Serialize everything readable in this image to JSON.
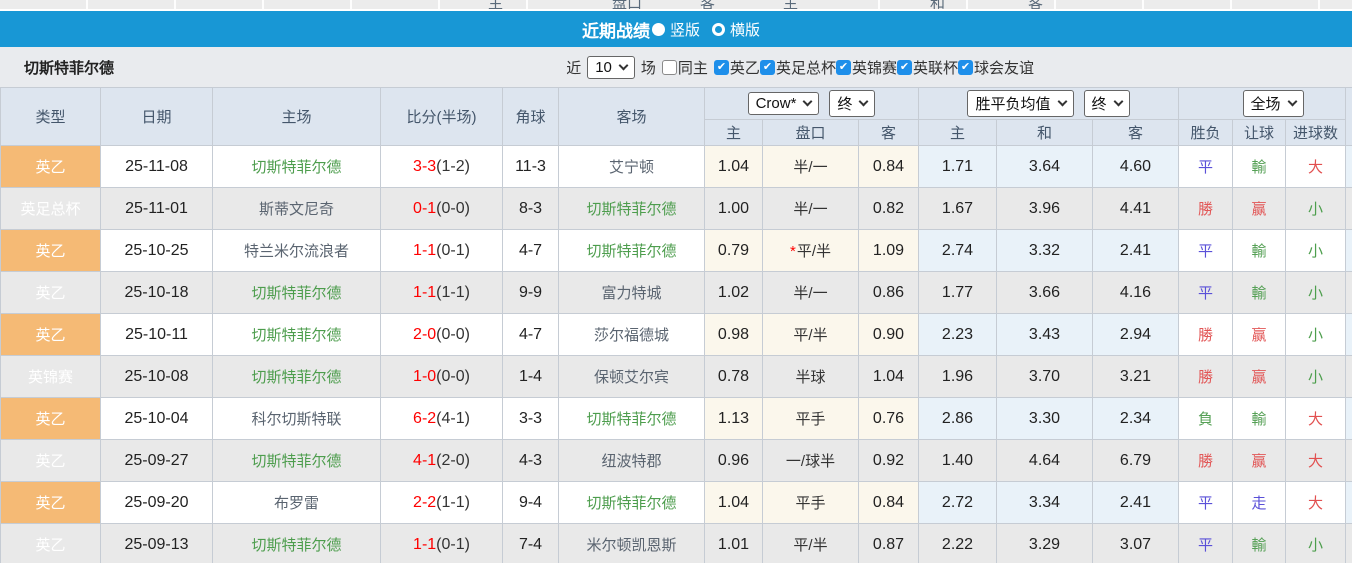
{
  "top_strip": {
    "labels": [
      "主",
      "盘口",
      "客",
      "主",
      "和",
      "客"
    ]
  },
  "title_bar": {
    "title": "近期战绩",
    "radios": [
      {
        "label": "竖版",
        "selected": true
      },
      {
        "label": "横版",
        "selected": false
      }
    ]
  },
  "filter_bar": {
    "team": "切斯特菲尔德",
    "near_label": "近",
    "count_value": "10",
    "games_label": "场",
    "same_home": {
      "label": "同主",
      "checked": false
    },
    "leagues": [
      {
        "label": "英乙",
        "checked": true
      },
      {
        "label": "英足总杯",
        "checked": true
      },
      {
        "label": "英锦赛",
        "checked": true
      },
      {
        "label": "英联杯",
        "checked": true
      },
      {
        "label": "球会友谊",
        "checked": true
      }
    ]
  },
  "table": {
    "headers": {
      "type": "类型",
      "date": "日期",
      "home": "主场",
      "score": "比分(半场)",
      "corner": "角球",
      "away": "客场",
      "odds_home": "主",
      "odds_line": "盘口",
      "odds_away": "客",
      "mean_home": "主",
      "mean_draw": "和",
      "mean_away": "客",
      "result": "胜负",
      "handicap": "让球",
      "goals": "进球数"
    },
    "selectors": {
      "bookmaker": "Crow*",
      "odds_time": "终",
      "mean_label": "胜平负均值",
      "mean_time": "终",
      "scope": "全场"
    },
    "rows": [
      {
        "league": "英乙",
        "league_style": "orange",
        "date": "25-11-08",
        "home": "切斯特菲尔德",
        "home_self": true,
        "score": "3-3",
        "half": "(1-2)",
        "corner": "11-3",
        "away": "艾宁顿",
        "away_self": false,
        "odds_home": "1.04",
        "line": "半/一",
        "line_star": false,
        "odds_away": "0.84",
        "mean_home": "1.71",
        "mean_draw": "3.64",
        "mean_away": "4.60",
        "result": "平",
        "result_state": "draw",
        "handicap": "輸",
        "handicap_state": "lose",
        "goals": "大",
        "goals_state": "over"
      },
      {
        "league": "英足总杯",
        "league_style": "blue",
        "date": "25-11-01",
        "home": "斯蒂文尼奇",
        "home_self": false,
        "score": "0-1",
        "half": "(0-0)",
        "corner": "8-3",
        "away": "切斯特菲尔德",
        "away_self": true,
        "odds_home": "1.00",
        "line": "半/一",
        "line_star": false,
        "odds_away": "0.82",
        "mean_home": "1.67",
        "mean_draw": "3.96",
        "mean_away": "4.41",
        "result": "勝",
        "result_state": "win",
        "handicap": "赢",
        "handicap_state": "win",
        "goals": "小",
        "goals_state": "under"
      },
      {
        "league": "英乙",
        "league_style": "orange",
        "date": "25-10-25",
        "home": "特兰米尔流浪者",
        "home_self": false,
        "score": "1-1",
        "half": "(0-1)",
        "corner": "4-7",
        "away": "切斯特菲尔德",
        "away_self": true,
        "odds_home": "0.79",
        "line": "平/半",
        "line_star": true,
        "odds_away": "1.09",
        "mean_home": "2.74",
        "mean_draw": "3.32",
        "mean_away": "2.41",
        "result": "平",
        "result_state": "draw",
        "handicap": "輸",
        "handicap_state": "lose",
        "goals": "小",
        "goals_state": "under"
      },
      {
        "league": "英乙",
        "league_style": "orange",
        "date": "25-10-18",
        "home": "切斯特菲尔德",
        "home_self": true,
        "score": "1-1",
        "half": "(1-1)",
        "corner": "9-9",
        "away": "富力特城",
        "away_self": false,
        "odds_home": "1.02",
        "line": "半/一",
        "line_star": false,
        "odds_away": "0.86",
        "mean_home": "1.77",
        "mean_draw": "3.66",
        "mean_away": "4.16",
        "result": "平",
        "result_state": "draw",
        "handicap": "輸",
        "handicap_state": "lose",
        "goals": "小",
        "goals_state": "under"
      },
      {
        "league": "英乙",
        "league_style": "orange",
        "date": "25-10-11",
        "home": "切斯特菲尔德",
        "home_self": true,
        "score": "2-0",
        "half": "(0-0)",
        "corner": "4-7",
        "away": "莎尔福德城",
        "away_self": false,
        "odds_home": "0.98",
        "line": "平/半",
        "line_star": false,
        "odds_away": "0.90",
        "mean_home": "2.23",
        "mean_draw": "3.43",
        "mean_away": "2.94",
        "result": "勝",
        "result_state": "win",
        "handicap": "赢",
        "handicap_state": "win",
        "goals": "小",
        "goals_state": "under"
      },
      {
        "league": "英锦赛",
        "league_style": "pink",
        "date": "25-10-08",
        "home": "切斯特菲尔德",
        "home_self": true,
        "score": "1-0",
        "half": "(0-0)",
        "corner": "1-4",
        "away": "保顿艾尔宾",
        "away_self": false,
        "odds_home": "0.78",
        "line": "半球",
        "line_star": false,
        "odds_away": "1.04",
        "mean_home": "1.96",
        "mean_draw": "3.70",
        "mean_away": "3.21",
        "result": "勝",
        "result_state": "win",
        "handicap": "赢",
        "handicap_state": "win",
        "goals": "小",
        "goals_state": "under"
      },
      {
        "league": "英乙",
        "league_style": "orange",
        "date": "25-10-04",
        "home": "科尔切斯特联",
        "home_self": false,
        "score": "6-2",
        "half": "(4-1)",
        "corner": "3-3",
        "away": "切斯特菲尔德",
        "away_self": true,
        "odds_home": "1.13",
        "line": "平手",
        "line_star": false,
        "odds_away": "0.76",
        "mean_home": "2.86",
        "mean_draw": "3.30",
        "mean_away": "2.34",
        "result": "負",
        "result_state": "lose",
        "handicap": "輸",
        "handicap_state": "lose",
        "goals": "大",
        "goals_state": "over"
      },
      {
        "league": "英乙",
        "league_style": "orange",
        "date": "25-09-27",
        "home": "切斯特菲尔德",
        "home_self": true,
        "score": "4-1",
        "half": "(2-0)",
        "corner": "4-3",
        "away": "纽波特郡",
        "away_self": false,
        "odds_home": "0.96",
        "line": "一/球半",
        "line_star": false,
        "odds_away": "0.92",
        "mean_home": "1.40",
        "mean_draw": "4.64",
        "mean_away": "6.79",
        "result": "勝",
        "result_state": "win",
        "handicap": "赢",
        "handicap_state": "win",
        "goals": "大",
        "goals_state": "over"
      },
      {
        "league": "英乙",
        "league_style": "orange",
        "date": "25-09-20",
        "home": "布罗雷",
        "home_self": false,
        "score": "2-2",
        "half": "(1-1)",
        "corner": "9-4",
        "away": "切斯特菲尔德",
        "away_self": true,
        "odds_home": "1.04",
        "line": "平手",
        "line_star": false,
        "odds_away": "0.84",
        "mean_home": "2.72",
        "mean_draw": "3.34",
        "mean_away": "2.41",
        "result": "平",
        "result_state": "draw",
        "handicap": "走",
        "handicap_state": "push",
        "goals": "大",
        "goals_state": "over"
      },
      {
        "league": "英乙",
        "league_style": "orange",
        "date": "25-09-13",
        "home": "切斯特菲尔德",
        "home_self": true,
        "score": "1-1",
        "half": "(0-1)",
        "corner": "7-4",
        "away": "米尔顿凯恩斯",
        "away_self": false,
        "odds_home": "1.01",
        "line": "平/半",
        "line_star": false,
        "odds_away": "0.87",
        "mean_home": "2.22",
        "mean_draw": "3.29",
        "mean_away": "3.07",
        "result": "平",
        "result_state": "draw",
        "handicap": "輸",
        "handicap_state": "lose",
        "goals": "小",
        "goals_state": "under"
      }
    ]
  },
  "colors": {
    "title_bar_bg": "#1897d5",
    "checkbox_blue": "#1e8fea",
    "league_orange": "#f5ba75",
    "league_blue": "#1212be",
    "league_pink": "#f43b72",
    "self_team_green": "#4d9d4d",
    "score_red": "#ff0000",
    "win_red": "#e25757",
    "draw_blue": "#5a50d8",
    "lose_green": "#55a055",
    "over_red": "#e25050",
    "under_green": "#4d9e4d",
    "odds_col_bg": "#fbf7ec",
    "mean_col_bg": "#e9f2f9",
    "alt_row_bg": "#e9e9e9",
    "header_bg": "#dde5ef",
    "filter_bar_bg": "#e9ebee"
  }
}
